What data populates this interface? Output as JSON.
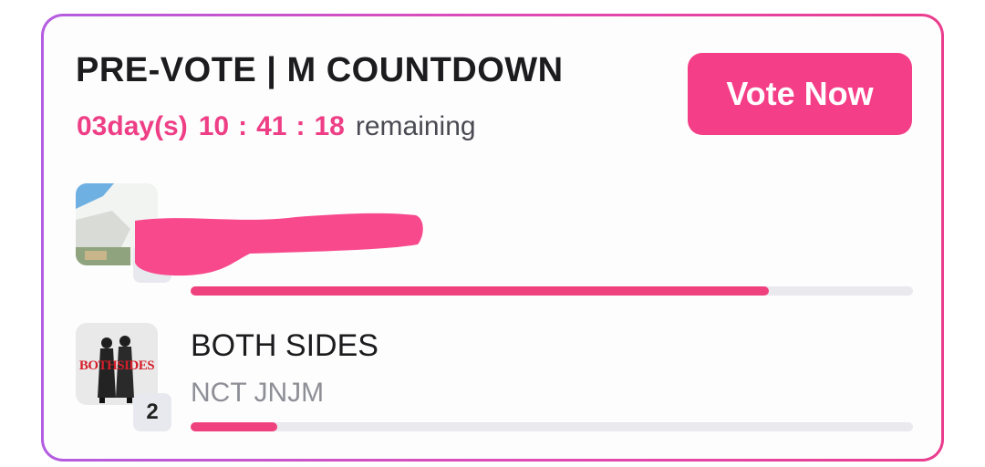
{
  "header": {
    "title": "PRE-VOTE | M COUNTDOWN",
    "countdown": {
      "days": "03day(s)",
      "hours": "10",
      "minutes": "41",
      "seconds": "18",
      "separator": ":",
      "suffix": "remaining"
    },
    "vote_button_label": "Vote Now"
  },
  "candidates": [
    {
      "rank": "",
      "title": "",
      "artist": "",
      "progress": 0.8,
      "redacted": true
    },
    {
      "rank": "2",
      "title": "BOTH SIDES",
      "artist": "NCT JNJM",
      "progress": 0.12,
      "album_art_text": "BOTHSIDES"
    }
  ],
  "colors": {
    "accent": "#f43e87",
    "progress": "#f0417f",
    "track": "#e9e9ee"
  }
}
